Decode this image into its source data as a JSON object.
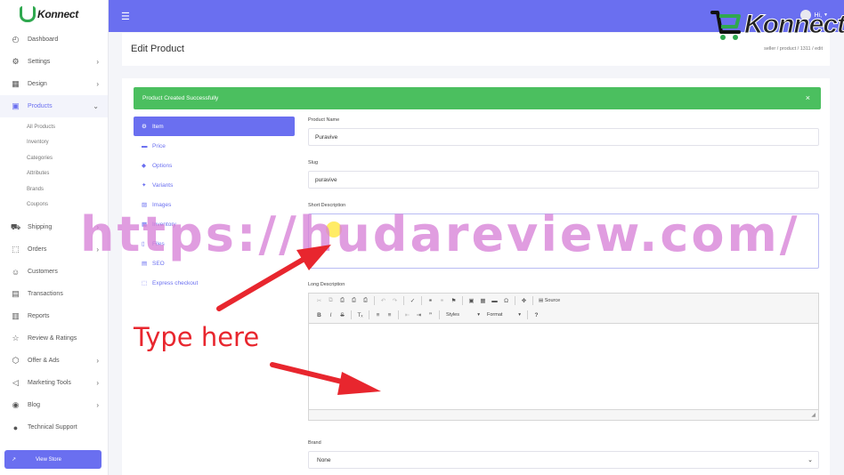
{
  "brand": {
    "name": "Konnect"
  },
  "sidebar": {
    "items": [
      {
        "label": "Dashboard",
        "icon": "dashboard-icon",
        "chevron": false
      },
      {
        "label": "Settings",
        "icon": "gear-icon",
        "chevron": true
      },
      {
        "label": "Design",
        "icon": "layout-icon",
        "chevron": true
      },
      {
        "label": "Products",
        "icon": "box-icon",
        "chevron": true,
        "active": true
      }
    ],
    "products_sub": [
      "All Products",
      "Inventory",
      "Categories",
      "Attributes",
      "Brands",
      "Coupons"
    ],
    "items_after": [
      {
        "label": "Shipping",
        "icon": "truck-icon",
        "chevron": true
      },
      {
        "label": "Orders",
        "icon": "cart-icon",
        "chevron": true
      },
      {
        "label": "Customers",
        "icon": "users-icon",
        "chevron": false
      },
      {
        "label": "Transactions",
        "icon": "money-icon",
        "chevron": false
      },
      {
        "label": "Reports",
        "icon": "chart-icon",
        "chevron": false
      },
      {
        "label": "Review & Ratings",
        "icon": "star-icon",
        "chevron": false
      },
      {
        "label": "Offer & Ads",
        "icon": "tag-icon",
        "chevron": true
      },
      {
        "label": "Marketing Tools",
        "icon": "megaphone-icon",
        "chevron": true
      },
      {
        "label": "Blog",
        "icon": "blog-icon",
        "chevron": true
      },
      {
        "label": "Technical Support",
        "icon": "person-icon",
        "chevron": false
      }
    ],
    "view_store_label": "View Store"
  },
  "topbar": {
    "greeting": "Hi,"
  },
  "header": {
    "title": "Edit Product",
    "breadcrumb": "seller / product / 1311 / edit"
  },
  "alert": {
    "message": "Product Created Successfully",
    "close": "×"
  },
  "tabs": [
    {
      "label": "Item",
      "icon": "cogs-icon",
      "active": true
    },
    {
      "label": "Price",
      "icon": "money-bill-icon"
    },
    {
      "label": "Options",
      "icon": "tags-icon"
    },
    {
      "label": "Variants",
      "icon": "variants-icon"
    },
    {
      "label": "Images",
      "icon": "images-icon"
    },
    {
      "label": "Inventory",
      "icon": "inventory-icon"
    },
    {
      "label": "Files",
      "icon": "file-icon"
    },
    {
      "label": "SEO",
      "icon": "seo-icon"
    },
    {
      "label": "Express checkout",
      "icon": "cart-icon"
    }
  ],
  "form": {
    "product_name_label": "Product Name",
    "product_name_value": "Puravive",
    "slug_label": "Slug",
    "slug_value": "puravive",
    "short_description_label": "Short Description",
    "short_description_value": "",
    "long_description_label": "Long Description",
    "editor_source_label": "Source",
    "editor_styles_label": "Styles",
    "editor_format_label": "Format",
    "brand_label": "Brand",
    "brand_value": "None"
  },
  "overlay": {
    "watermark_url": "https://hudareview.com/",
    "annotation": "Type here",
    "watermark_logo": "Konnect",
    "accent_red": "#e8262e"
  },
  "colors": {
    "primary": "#6a6ff0",
    "success": "#4bbf5f"
  }
}
